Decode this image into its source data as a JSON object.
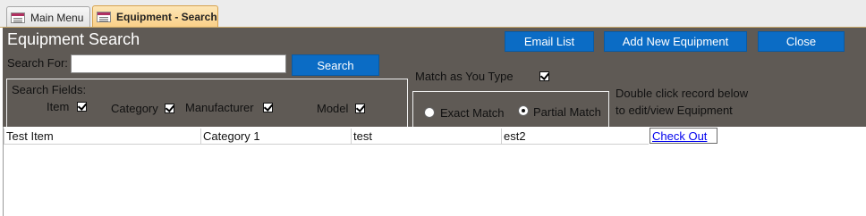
{
  "tabs": [
    {
      "label": "Main Menu",
      "active": false
    },
    {
      "label": "Equipment - Search",
      "active": true
    }
  ],
  "header": {
    "title": "Equipment Search",
    "buttons": {
      "email_list": "Email List",
      "add_new": "Add New Equipment",
      "close": "Close"
    },
    "search_for_label": "Search For:",
    "search_value": "",
    "search_button": "Search",
    "search_fields_label": "Search Fields:",
    "fields": [
      {
        "label": "Item",
        "checked": true
      },
      {
        "label": "Category",
        "checked": true
      },
      {
        "label": "Manufacturer",
        "checked": true
      },
      {
        "label": "Model",
        "checked": true
      }
    ],
    "match_as_you_type_label": "Match as You Type",
    "match_as_you_type": true,
    "match_mode": {
      "exact_label": "Exact Match",
      "partial_label": "Partial Match",
      "selected": "partial"
    },
    "instructions_line1": "Double click record below",
    "instructions_line2": "to edit/view Equipment"
  },
  "results": {
    "rows": [
      {
        "item": "Test Item",
        "category": "Category 1",
        "manufacturer": "test",
        "model": "est2",
        "action": "Check Out"
      }
    ]
  },
  "colors": {
    "header_bg": "#5f5a55",
    "button_bg": "#0b6cc5",
    "active_tab": "#f9cf86",
    "link": "#0000ee"
  }
}
